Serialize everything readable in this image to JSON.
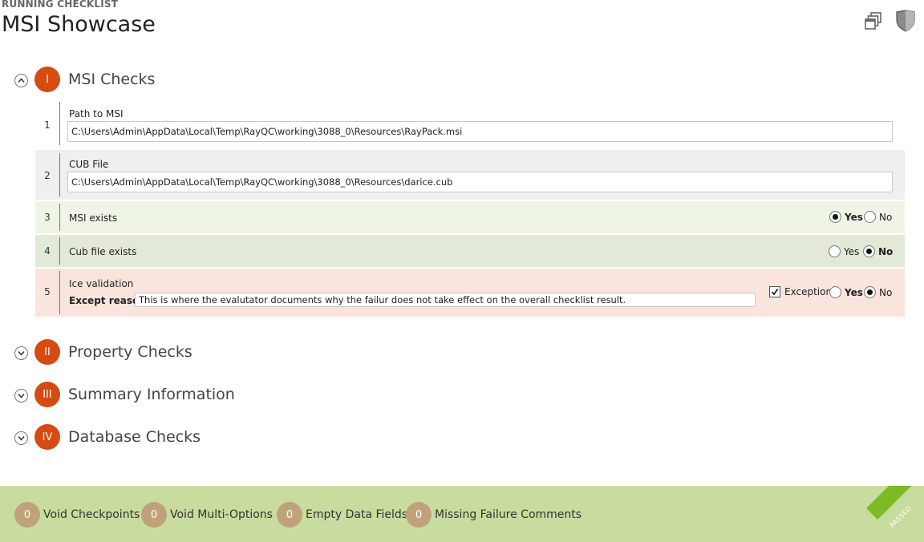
{
  "header": {
    "subtitle": "RUNNING CHECKLIST",
    "title": "MSI Showcase",
    "icons": [
      "windows-icon",
      "shield-icon"
    ]
  },
  "sections": [
    {
      "numeral": "I",
      "title": "MSI Checks",
      "expanded": true
    },
    {
      "numeral": "II",
      "title": "Property Checks",
      "expanded": false
    },
    {
      "numeral": "III",
      "title": "Summary Information",
      "expanded": false
    },
    {
      "numeral": "IV",
      "title": "Database Checks",
      "expanded": false
    }
  ],
  "rows": [
    {
      "num": "1",
      "label": "Path to MSI",
      "value": "C:\\Users\\Admin\\AppData\\Local\\Temp\\RayQC\\working\\3088_0\\Resources\\RayPack.msi"
    },
    {
      "num": "2",
      "label": "CUB File",
      "value": "C:\\Users\\Admin\\AppData\\Local\\Temp\\RayQC\\working\\3088_0\\Resources\\darice.cub"
    },
    {
      "num": "3",
      "label": "MSI exists",
      "yes": "Yes",
      "no": "No",
      "selected": "Yes"
    },
    {
      "num": "4",
      "label": "Cub file exists",
      "yes": "Yes",
      "no": "No",
      "selected": "No"
    },
    {
      "num": "5",
      "label": "Ice validation",
      "except_label": "Except reason",
      "except_value": "This is where the evalutator documents why the failur does not take effect on the overall checklist result.",
      "exception_label": "Exception",
      "exception_checked": true,
      "yes": "Yes",
      "no": "No",
      "selected": "No"
    }
  ],
  "colors": {
    "accent": "#d64b12",
    "row2_bg": "#efefef",
    "row3_bg": "#eef5e6",
    "row4_bg": "#e2e9d9",
    "row5_bg": "#f9e4de",
    "footer_bg": "#c9dc9f",
    "passed": "#7cbb25",
    "badge": "#c0a27a"
  },
  "footer": {
    "badges": [
      {
        "count": "0",
        "label": "Void Checkpoints"
      },
      {
        "count": "0",
        "label": "Void Multi-Options"
      },
      {
        "count": "0",
        "label": "Empty Data Fields"
      },
      {
        "count": "0",
        "label": "Missing Failure Comments"
      }
    ],
    "status": "PASSED"
  }
}
